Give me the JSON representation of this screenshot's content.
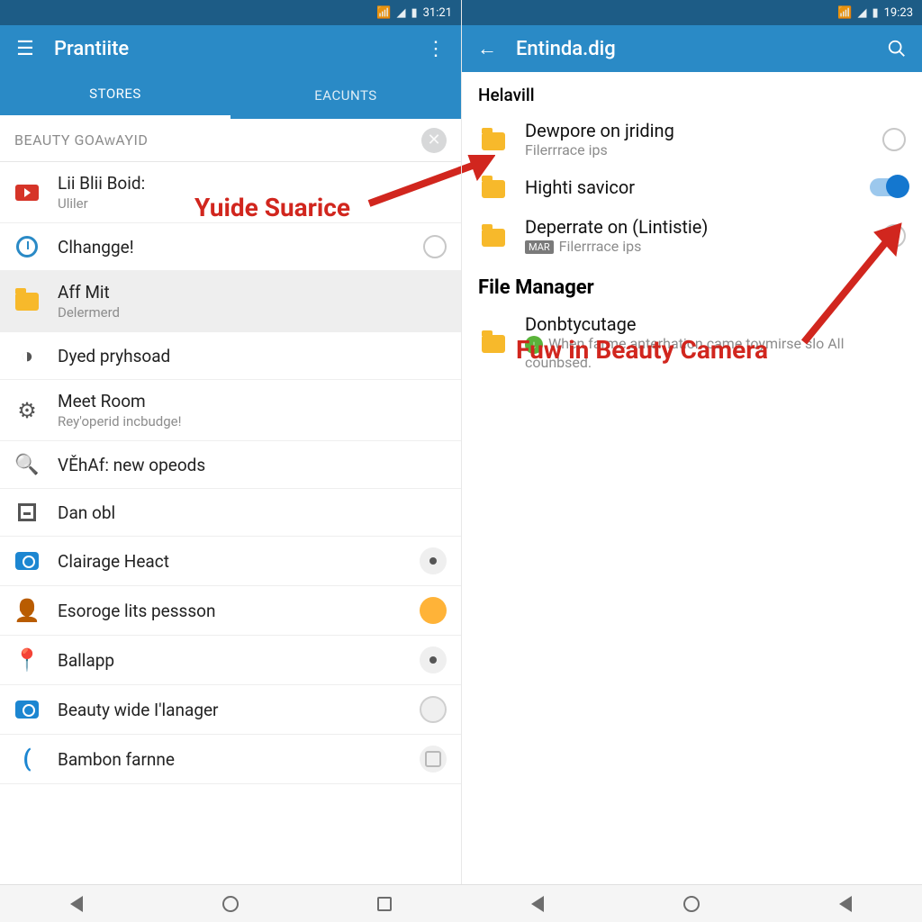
{
  "left": {
    "status_time": "31:21",
    "title": "Prantiite",
    "tabs": [
      "STORES",
      "EACUNTS"
    ],
    "search_value": "BEAUTY GOAᴡAYID",
    "items": [
      {
        "icon": "ic-red",
        "primary": "Lii Blii Boid:",
        "secondary": "Uliler",
        "trail": ""
      },
      {
        "icon": "ic-clock",
        "primary": "Clhangge!",
        "secondary": "",
        "trail": "radio"
      },
      {
        "icon": "ic-folder",
        "primary": "Aff Mit",
        "secondary": "Delermerd",
        "trail": "",
        "selected": true
      },
      {
        "icon": "moon",
        "primary": "Dyed pryhsoad",
        "secondary": "",
        "trail": ""
      },
      {
        "icon": "ic-gear",
        "primary": "Meet Room",
        "secondary": "Rey'operid incbudge!",
        "trail": ""
      },
      {
        "icon": "ic-search",
        "primary": "VĚhAf: new opeods",
        "secondary": "",
        "trail": ""
      },
      {
        "icon": "ic-square",
        "primary": "Dan obl",
        "secondary": "",
        "trail": ""
      },
      {
        "icon": "ic-cam",
        "primary": "Clairage Heact",
        "secondary": "",
        "trail": "dot-dark"
      },
      {
        "icon": "ic-user",
        "primary": "Esoroge lits pessson",
        "secondary": "",
        "trail": "dot-orange"
      },
      {
        "icon": "ic-pin",
        "primary": "Ballapp",
        "secondary": "",
        "trail": "dot-dark"
      },
      {
        "icon": "ic-cam",
        "primary": "Beauty wide I'lanager",
        "secondary": "",
        "trail": "dot-white"
      },
      {
        "icon": "ic-brace",
        "primary": "Bambon farnne",
        "secondary": "",
        "trail": "dot-box"
      }
    ],
    "annotation": "Yuide Suarice"
  },
  "right": {
    "status_time": "19:23",
    "title": "Entinda.dig",
    "section1": "Helavill",
    "rows1": [
      {
        "primary": "Dewpore on jriding",
        "secondary": "Filerrrace ips",
        "trail": "radio"
      },
      {
        "primary": "Highti savicor",
        "secondary": "",
        "trail": "toggle-on"
      },
      {
        "primary": "Deperrate on (Lintistie)",
        "secondary": "Filerrrace ips",
        "trail": "radio",
        "chip": "MAR"
      }
    ],
    "section2": "File Manager",
    "rows2": [
      {
        "primary": "Donbtycutage",
        "secondary": "When farme anterhation came toymirse slo All counbsed."
      }
    ],
    "annotation": "Fuw in Beauty Camera"
  }
}
